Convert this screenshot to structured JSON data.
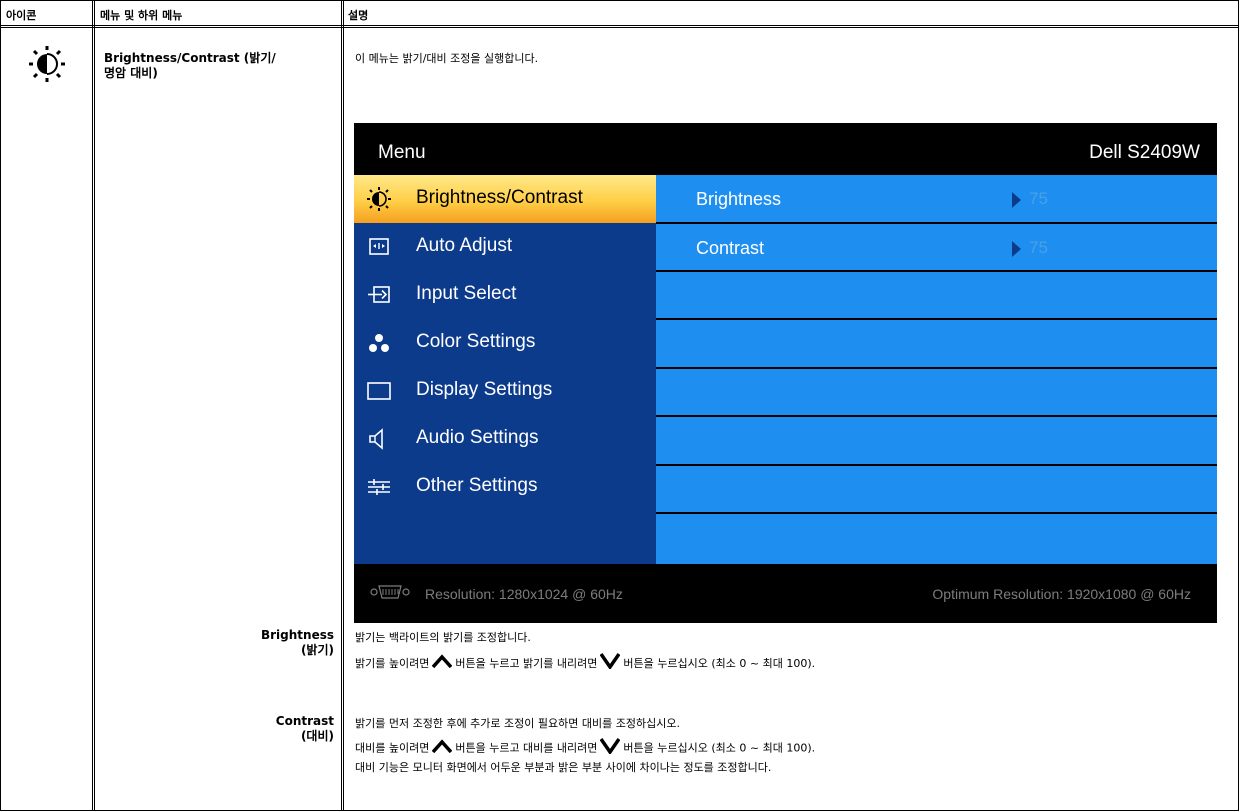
{
  "table": {
    "headers": {
      "icon": "아이콘",
      "menu": "메뉴 및 하위 메뉴",
      "desc": "설명"
    }
  },
  "brightness_contrast": {
    "icon": "brightness-icon",
    "menu_title_line1": "Brightness/Contrast (밝기/",
    "menu_title_line2": "명암 대비)",
    "description": "이 메뉴는 밝기/대비 조정을 실행합니다."
  },
  "osd": {
    "title": "Menu",
    "model": "Dell S2409W",
    "items": [
      {
        "label": "Brightness/Contrast",
        "icon": "brightness-icon"
      },
      {
        "label": "Auto Adjust",
        "icon": "auto-adjust-icon"
      },
      {
        "label": "Input Select",
        "icon": "input-select-icon"
      },
      {
        "label": "Color Settings",
        "icon": "color-settings-icon"
      },
      {
        "label": "Display Settings",
        "icon": "display-settings-icon"
      },
      {
        "label": "Audio Settings",
        "icon": "audio-settings-icon"
      },
      {
        "label": "Other Settings",
        "icon": "other-settings-icon"
      }
    ],
    "rows": [
      {
        "label": "Brightness",
        "value": "75"
      },
      {
        "label": "Contrast",
        "value": "75"
      }
    ],
    "resolution": "Resolution: 1280x1024 @ 60Hz",
    "optimum": "Optimum Resolution: 1920x1080 @ 60Hz",
    "colors": {
      "menu_blue": "#0d3b8c",
      "row_blue": "#1e8ff0",
      "highlight": "#ffce46"
    }
  },
  "brightness": {
    "label_line1": "Brightness",
    "label_line2": "(밝기)",
    "desc_line1": "밝기는 백라이트의 밝기를 조정합니다.",
    "desc_line2_a": "밝기를 높이려면",
    "desc_line2_b": "버튼을 누르고 밝기를 내리려면",
    "desc_line2_c": "버튼을 누르십시오 (최소 0 ~ 최대 100)."
  },
  "contrast": {
    "label_line1": "Contrast",
    "label_line2": "(대비)",
    "desc_line1": "밝기를 먼저 조정한 후에 추가로 조정이 필요하면 대비를 조정하십시오.",
    "desc_line2_a": "대비를 높이려면",
    "desc_line2_b": "버튼을 누르고 대비를 내리려면",
    "desc_line2_c": "버튼을 누르십시오 (최소 0 ~ 최대 100).",
    "desc_line3": "대비 기능은 모니터 화면에서 어두운 부분과 밝은 부분 사이에 차이나는 정도를 조정합니다."
  }
}
